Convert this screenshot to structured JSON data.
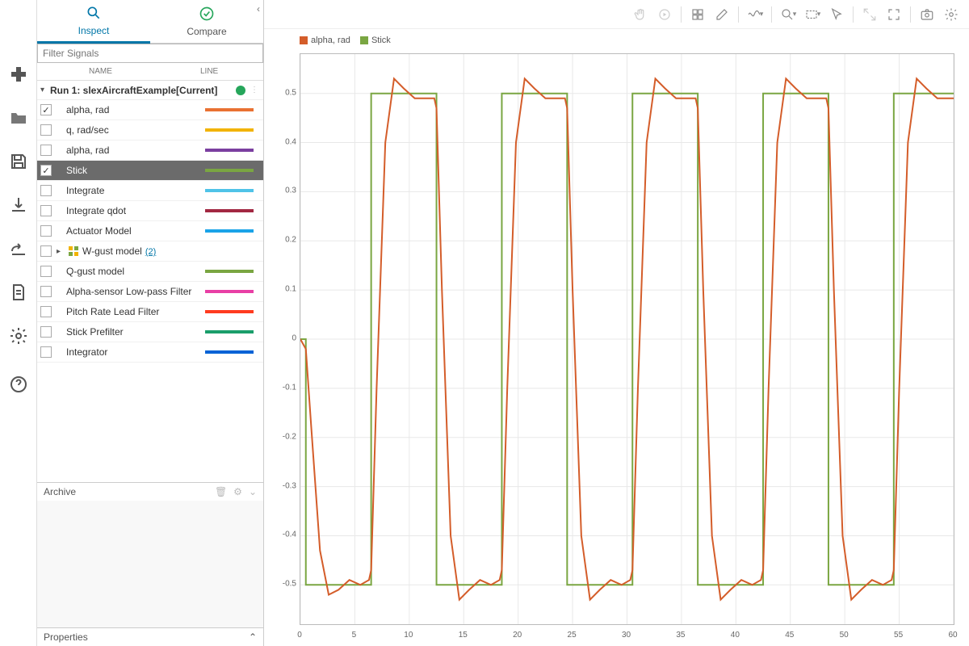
{
  "tabs": {
    "inspect": "Inspect",
    "compare": "Compare"
  },
  "filter_placeholder": "Filter Signals",
  "columns": {
    "name": "NAME",
    "line": "LINE"
  },
  "run": {
    "label": "Run 1: slexAircraftExample[Current]"
  },
  "signals": [
    {
      "name": "alpha, rad",
      "checked": true,
      "color": "#e97132",
      "sel": false
    },
    {
      "name": "q, rad/sec",
      "checked": false,
      "color": "#f2b300",
      "sel": false
    },
    {
      "name": "alpha, rad",
      "checked": false,
      "color": "#7b3fa0",
      "sel": false
    },
    {
      "name": "Stick",
      "checked": true,
      "color": "#7aa642",
      "sel": true
    },
    {
      "name": "Integrate",
      "checked": false,
      "color": "#4fc3e8",
      "sel": false
    },
    {
      "name": "Integrate qdot",
      "checked": false,
      "color": "#a22842",
      "sel": false
    },
    {
      "name": "Actuator Model",
      "checked": false,
      "color": "#1aa3e8",
      "sel": false
    },
    {
      "name": "W-gust model",
      "checked": false,
      "color": "",
      "sel": false,
      "group": "(2)",
      "expandable": true
    },
    {
      "name": "Q-gust model",
      "checked": false,
      "color": "#7aa642",
      "sel": false
    },
    {
      "name": "Alpha-sensor Low-pass Filter",
      "checked": false,
      "color": "#e83fa5",
      "sel": false
    },
    {
      "name": "Pitch Rate Lead Filter",
      "checked": false,
      "color": "#ff3b1f",
      "sel": false
    },
    {
      "name": "Stick Prefilter",
      "checked": false,
      "color": "#1a9e6b",
      "sel": false
    },
    {
      "name": "Integrator",
      "checked": false,
      "color": "#0062d6",
      "sel": false
    }
  ],
  "archive": {
    "label": "Archive"
  },
  "properties": {
    "label": "Properties"
  },
  "legend": [
    {
      "label": "alpha, rad",
      "color": "#d45d2a"
    },
    {
      "label": "Stick",
      "color": "#7aa642"
    }
  ],
  "chart_data": {
    "type": "line",
    "xlabel": "",
    "ylabel": "",
    "xlim": [
      0,
      60
    ],
    "ylim": [
      -0.58,
      0.58
    ],
    "xticks": [
      0,
      5,
      10,
      15,
      20,
      25,
      30,
      35,
      40,
      45,
      50,
      55,
      60
    ],
    "yticks": [
      -0.5,
      -0.4,
      -0.3,
      -0.2,
      -0.1,
      0,
      0.1,
      0.2,
      0.3,
      0.4,
      0.5
    ],
    "series": [
      {
        "name": "Stick",
        "color": "#7aa642",
        "x": [
          0,
          0.5,
          0.5,
          6.5,
          6.5,
          12.5,
          12.5,
          18.5,
          18.5,
          24.5,
          24.5,
          30.5,
          30.5,
          36.5,
          36.5,
          42.5,
          42.5,
          48.5,
          48.5,
          54.5,
          54.5,
          60
        ],
        "y": [
          0,
          0,
          -0.5,
          -0.5,
          0.5,
          0.5,
          -0.5,
          -0.5,
          0.5,
          0.5,
          -0.5,
          -0.5,
          0.5,
          0.5,
          -0.5,
          -0.5,
          0.5,
          0.5,
          -0.5,
          -0.5,
          0.5,
          0.5
        ]
      },
      {
        "name": "alpha, rad",
        "color": "#d45d2a",
        "x": [
          0,
          0.5,
          1.0,
          1.8,
          2.6,
          3.5,
          4.5,
          5.5,
          6.3,
          6.5,
          7.0,
          7.8,
          8.6,
          9.5,
          10.5,
          11.5,
          12.3,
          12.5,
          13.0,
          13.8,
          14.6,
          15.5,
          16.5,
          17.5,
          18.3,
          18.5,
          19.0,
          19.8,
          20.6,
          21.5,
          22.5,
          23.5,
          24.3,
          24.5,
          25.0,
          25.8,
          26.6,
          27.5,
          28.5,
          29.5,
          30.3,
          30.5,
          31.0,
          31.8,
          32.6,
          33.5,
          34.5,
          35.5,
          36.3,
          36.5,
          37.0,
          37.8,
          38.6,
          39.5,
          40.5,
          41.5,
          42.3,
          42.5,
          43.0,
          43.8,
          44.6,
          45.5,
          46.5,
          47.5,
          48.3,
          48.5,
          49.0,
          49.8,
          50.6,
          51.5,
          52.5,
          53.5,
          54.3,
          54.5,
          55.0,
          55.8,
          56.6,
          57.5,
          58.5,
          59.5,
          60
        ],
        "y": [
          0,
          -0.02,
          -0.18,
          -0.43,
          -0.52,
          -0.51,
          -0.49,
          -0.5,
          -0.49,
          -0.47,
          -0.1,
          0.4,
          0.53,
          0.51,
          0.49,
          0.49,
          0.49,
          0.47,
          0.1,
          -0.4,
          -0.53,
          -0.51,
          -0.49,
          -0.5,
          -0.49,
          -0.47,
          -0.1,
          0.4,
          0.53,
          0.51,
          0.49,
          0.49,
          0.49,
          0.47,
          0.1,
          -0.4,
          -0.53,
          -0.51,
          -0.49,
          -0.5,
          -0.49,
          -0.47,
          -0.1,
          0.4,
          0.53,
          0.51,
          0.49,
          0.49,
          0.49,
          0.47,
          0.1,
          -0.4,
          -0.53,
          -0.51,
          -0.49,
          -0.5,
          -0.49,
          -0.47,
          -0.1,
          0.4,
          0.53,
          0.51,
          0.49,
          0.49,
          0.49,
          0.47,
          0.1,
          -0.4,
          -0.53,
          -0.51,
          -0.49,
          -0.5,
          -0.49,
          -0.47,
          -0.1,
          0.4,
          0.53,
          0.51,
          0.49,
          0.49,
          0.49
        ]
      }
    ]
  }
}
